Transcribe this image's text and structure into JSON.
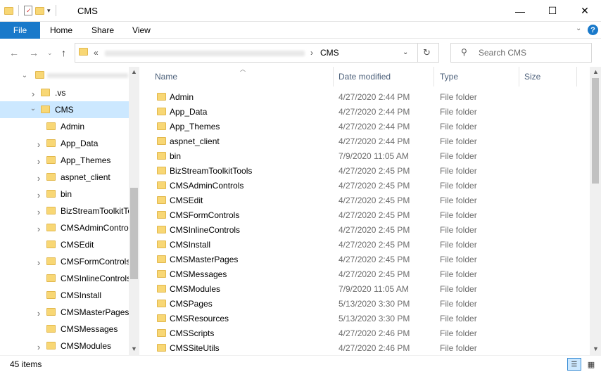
{
  "window": {
    "title": "CMS",
    "minimize": "—",
    "maximize": "☐",
    "close": "✕"
  },
  "ribbon": {
    "file": "File",
    "tabs": [
      "Home",
      "Share",
      "View"
    ],
    "help": "?"
  },
  "address": {
    "prefix": "«",
    "current": "CMS",
    "separator": "›"
  },
  "search": {
    "placeholder": "Search CMS"
  },
  "tree": {
    "items": [
      {
        "label": ".vs",
        "expandable": true,
        "depth": 1
      },
      {
        "label": "CMS",
        "expandable": true,
        "expanded": true,
        "selected": true,
        "depth": 1
      },
      {
        "label": "Admin",
        "expandable": false,
        "depth": 2
      },
      {
        "label": "App_Data",
        "expandable": true,
        "depth": 2
      },
      {
        "label": "App_Themes",
        "expandable": true,
        "depth": 2
      },
      {
        "label": "aspnet_client",
        "expandable": true,
        "depth": 2
      },
      {
        "label": "bin",
        "expandable": true,
        "depth": 2
      },
      {
        "label": "BizStreamToolkitTools",
        "expandable": true,
        "depth": 2
      },
      {
        "label": "CMSAdminControls",
        "expandable": true,
        "depth": 2
      },
      {
        "label": "CMSEdit",
        "expandable": false,
        "depth": 2
      },
      {
        "label": "CMSFormControls",
        "expandable": true,
        "depth": 2
      },
      {
        "label": "CMSInlineControls",
        "expandable": false,
        "depth": 2
      },
      {
        "label": "CMSInstall",
        "expandable": false,
        "depth": 2
      },
      {
        "label": "CMSMasterPages",
        "expandable": true,
        "depth": 2
      },
      {
        "label": "CMSMessages",
        "expandable": false,
        "depth": 2
      },
      {
        "label": "CMSModules",
        "expandable": true,
        "depth": 2
      }
    ]
  },
  "columns": {
    "name": "Name",
    "date": "Date modified",
    "type": "Type",
    "size": "Size"
  },
  "files": [
    {
      "name": "Admin",
      "date": "4/27/2020 2:44 PM",
      "type": "File folder"
    },
    {
      "name": "App_Data",
      "date": "4/27/2020 2:44 PM",
      "type": "File folder"
    },
    {
      "name": "App_Themes",
      "date": "4/27/2020 2:44 PM",
      "type": "File folder"
    },
    {
      "name": "aspnet_client",
      "date": "4/27/2020 2:44 PM",
      "type": "File folder"
    },
    {
      "name": "bin",
      "date": "7/9/2020 11:05 AM",
      "type": "File folder"
    },
    {
      "name": "BizStreamToolkitTools",
      "date": "4/27/2020 2:45 PM",
      "type": "File folder"
    },
    {
      "name": "CMSAdminControls",
      "date": "4/27/2020 2:45 PM",
      "type": "File folder"
    },
    {
      "name": "CMSEdit",
      "date": "4/27/2020 2:45 PM",
      "type": "File folder"
    },
    {
      "name": "CMSFormControls",
      "date": "4/27/2020 2:45 PM",
      "type": "File folder"
    },
    {
      "name": "CMSInlineControls",
      "date": "4/27/2020 2:45 PM",
      "type": "File folder"
    },
    {
      "name": "CMSInstall",
      "date": "4/27/2020 2:45 PM",
      "type": "File folder"
    },
    {
      "name": "CMSMasterPages",
      "date": "4/27/2020 2:45 PM",
      "type": "File folder"
    },
    {
      "name": "CMSMessages",
      "date": "4/27/2020 2:45 PM",
      "type": "File folder"
    },
    {
      "name": "CMSModules",
      "date": "7/9/2020 11:05 AM",
      "type": "File folder"
    },
    {
      "name": "CMSPages",
      "date": "5/13/2020 3:30 PM",
      "type": "File folder"
    },
    {
      "name": "CMSResources",
      "date": "5/13/2020 3:30 PM",
      "type": "File folder"
    },
    {
      "name": "CMSScripts",
      "date": "4/27/2020 2:46 PM",
      "type": "File folder"
    },
    {
      "name": "CMSSiteUtils",
      "date": "4/27/2020 2:46 PM",
      "type": "File folder"
    }
  ],
  "status": {
    "count": "45 items"
  },
  "colors": {
    "accent": "#1979ca",
    "selection": "#cce8ff",
    "folder": "#f8d775"
  }
}
